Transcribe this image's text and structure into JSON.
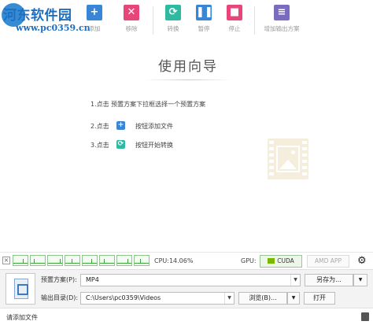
{
  "colors": {
    "accent_blue": "#3a86d6",
    "red": "#e8467a",
    "teal": "#2fb9a0",
    "purple": "#7b6bbf",
    "green": "#3aa63a"
  },
  "watermark": {
    "brand": "河东软件园",
    "url": "www.pc0359.cn"
  },
  "toolbar": {
    "add_label": "添加",
    "remove_label": "移除",
    "convert_label": "转换",
    "pause_label": "暂停",
    "stop_label": "停止",
    "add_output_label": "增加输出方案"
  },
  "wizard": {
    "title": "使用向导",
    "step1": "1.点击 预置方案下拉框选择一个预置方案",
    "step2_prefix": "2.点击",
    "step2_suffix": "按钮添加文件",
    "step3_prefix": "3.点击",
    "step3_suffix": "按钮开始转换"
  },
  "monitor": {
    "close_glyph": "×",
    "cpu": "CPU:14.06%",
    "gpu_label": "GPU:",
    "cuda": "CUDA",
    "amd": "AMD APP"
  },
  "panel": {
    "preset_label": "预置方案(P):",
    "preset_value": "MP4",
    "save_as": "另存为...",
    "output_label": "输出目录(D):",
    "output_value": "C:\\Users\\pc0359\\Videos",
    "browse": "浏览(B)...",
    "open": "打开"
  },
  "status": {
    "text": "请添加文件"
  }
}
